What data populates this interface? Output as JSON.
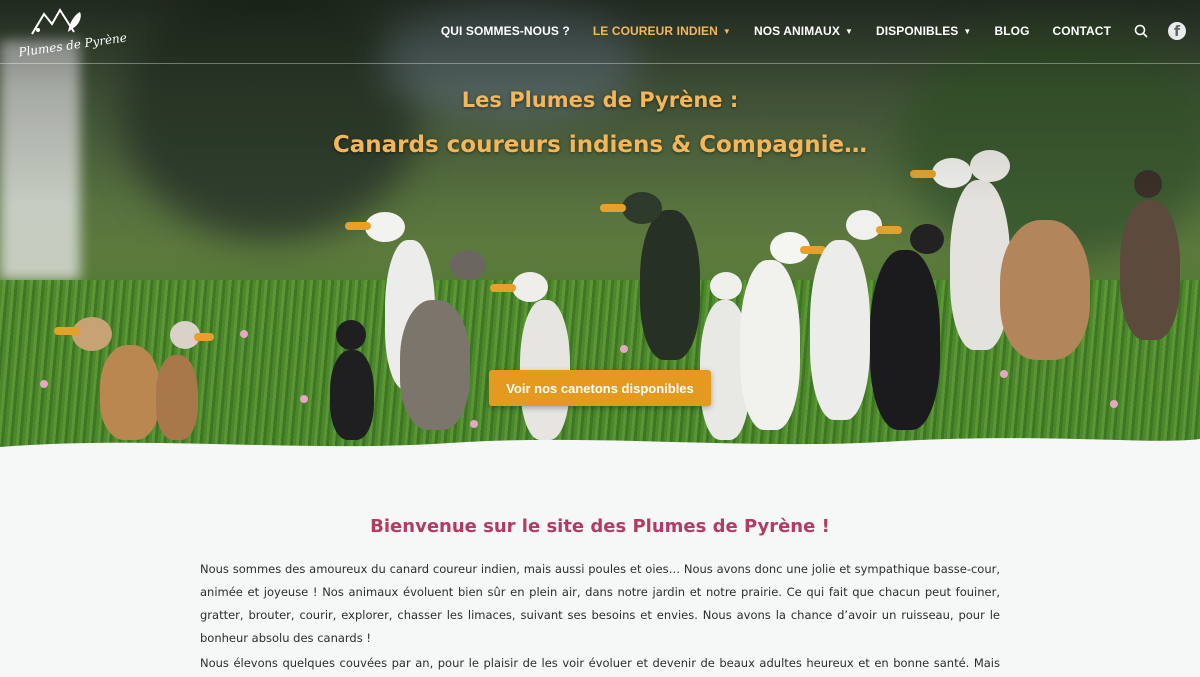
{
  "logo": {
    "text": "Plumes de Pyrène"
  },
  "nav": {
    "items": [
      {
        "label": "QUI SOMMES-NOUS ?",
        "caret": false
      },
      {
        "label": "LE COUREUR INDIEN",
        "caret": true
      },
      {
        "label": "NOS ANIMAUX",
        "caret": true
      },
      {
        "label": "DISPONIBLES",
        "caret": true
      },
      {
        "label": "BLOG",
        "caret": false
      },
      {
        "label": "CONTACT",
        "caret": false
      }
    ],
    "active_index": 1,
    "icons": [
      "search-icon",
      "facebook-icon"
    ]
  },
  "hero": {
    "title_line1": "Les Plumes de Pyrène :",
    "title_line2": "Canards coureurs indiens & Compagnie…",
    "cta_label": "Voir nos canetons disponibles"
  },
  "content": {
    "heading": "Bienvenue sur le site des Plumes de Pyrène !",
    "paragraph1": "Nous sommes des amoureux du canard coureur indien, mais aussi poules et oies… Nous avons donc une jolie et sympathique basse-cour, animée et joyeuse ! Nos animaux évoluent bien sûr en plein air, dans notre jardin et notre prairie. Ce qui fait que chacun peut fouiner, gratter, brouter, courir, explorer, chasser les limaces, suivant ses besoins et envies. Nous avons la chance d’avoir un ruisseau, pour le bonheur absolu des canards !",
    "paragraph2": "Nous élevons quelques couvées par an, pour le plaisir de les voir évoluer et devenir de beaux adultes heureux et en bonne santé. Mais aussi et"
  },
  "colors": {
    "accent": "#f3b75a",
    "cta": "#e39a1f",
    "heading": "#b23a63",
    "background": "#f6f8f7"
  }
}
